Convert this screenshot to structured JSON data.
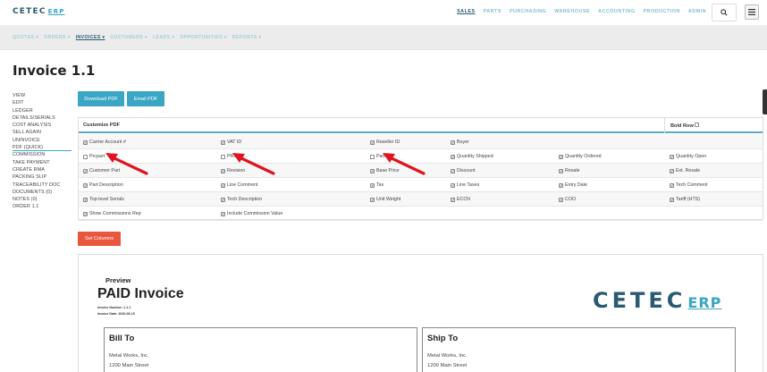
{
  "brand": {
    "name": "CETEC",
    "suffix": "ERP"
  },
  "topnav": [
    "SALES",
    "PARTS",
    "PURCHASING",
    "WAREHOUSE",
    "ACCOUNTING",
    "PRODUCTION",
    "ADMIN"
  ],
  "subnav": [
    "QUOTES ▾",
    "ORDERS ▾",
    "INVOICES ▾",
    "CUSTOMERS ▾",
    "LEADS ▾",
    "OPPORTUNITIES ▾",
    "REPORTS ▾"
  ],
  "page_title": "Invoice 1.1",
  "leftnav": [
    "VIEW",
    "EDIT",
    "LEDGER",
    "DETAILS/SERIALS",
    "COST ANALYSIS",
    "SELL AGAIN",
    "UNINVOICE",
    "PDF (QUICK)",
    "COMMISSION",
    "TAKE PAYMENT",
    "CREATE RMA",
    "PACKING SLIP",
    "TRACEABILITY DOC",
    "DOCUMENTS (0)",
    "NOTES (0)",
    "ORDER 1.1"
  ],
  "buttons": {
    "download_pdf": "Download PDF",
    "email_pdf": "Email PDF",
    "set_columns": "Set Columns"
  },
  "customize": {
    "header": "Customize PDF",
    "bold_row": "Bold Row",
    "rows": [
      [
        {
          "label": "Carrier Account #",
          "checked": true
        },
        {
          "label": "VAT ID",
          "checked": true
        },
        {
          "label": "Reseller ID",
          "checked": true
        },
        {
          "label": "Buyer",
          "checked": true
        }
      ],
      [
        {
          "label": "Prcpart",
          "checked": false
        },
        {
          "label": "PRC",
          "checked": false
        },
        {
          "label": "Part #",
          "checked": false
        },
        {
          "label": "Quantity Shipped",
          "checked": true
        },
        {
          "label": "Quantity Ordered",
          "checked": true
        },
        {
          "label": "Quantity Open",
          "checked": true
        }
      ],
      [
        {
          "label": "Customer Part",
          "checked": true
        },
        {
          "label": "Revision",
          "checked": true
        },
        {
          "label": "Base Price",
          "checked": true
        },
        {
          "label": "Discount",
          "checked": true
        },
        {
          "label": "Resale",
          "checked": true
        },
        {
          "label": "Ext. Resale",
          "checked": true
        }
      ],
      [
        {
          "label": "Part Description",
          "checked": true
        },
        {
          "label": "Line Comment",
          "checked": true
        },
        {
          "label": "Tax",
          "checked": true
        },
        {
          "label": "Line Taxes",
          "checked": true
        },
        {
          "label": "Entry Date",
          "checked": true
        },
        {
          "label": "Tech Comment",
          "checked": true
        }
      ],
      [
        {
          "label": "Top-level Serials",
          "checked": true
        },
        {
          "label": "Tech Description",
          "checked": true
        },
        {
          "label": "Unit Weight",
          "checked": true
        },
        {
          "label": "ECCN",
          "checked": true
        },
        {
          "label": "COO",
          "checked": true
        },
        {
          "label": "Tariff (HTS)",
          "checked": true
        }
      ],
      [
        {
          "label": "Show Commissions Rep",
          "checked": true
        },
        {
          "label": "Include Commission Value",
          "checked": true
        }
      ]
    ]
  },
  "preview": {
    "label": "Preview",
    "title": "PAID Invoice",
    "invoice_number": "Invoice Number: 1.1-1",
    "invoice_date": "Invoice Date: 2020-05-15",
    "bill_to": {
      "heading": "Bill To",
      "lines": [
        "Metal Works, Inc.",
        "1200 Main Street"
      ]
    },
    "ship_to": {
      "heading": "Ship To",
      "lines": [
        "Metal Works, Inc.",
        "1200 Main Street"
      ]
    }
  },
  "colors": {
    "accent": "#3aa6c4",
    "brand": "#2a5b73",
    "danger": "#e8563d",
    "arrow": "#e0141e"
  }
}
